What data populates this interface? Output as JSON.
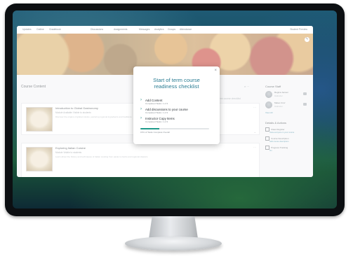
{
  "nav": {
    "items": [
      "Updates",
      "Outline",
      "Gradebook",
      "Discussions",
      "Assignments",
      "Messages",
      "Analytics",
      "Groups",
      "Attendance"
    ],
    "help": "Student Preview"
  },
  "content": {
    "title": "Course Content",
    "tools": "⌕  ···",
    "progress_note": "Start of term course checklist"
  },
  "modules": [
    {
      "title": "Introduction to Global Gastronomy",
      "meta": "Module   Available   Visible to students",
      "desc": "Discover the origins of global cuisine, exploring regional ingredients and traditions."
    },
    {
      "title": "Exploring Italian Cuisine",
      "meta": "Module   Visible to students",
      "desc": "Learn about the history and techniques of Italian cooking from pasta to risotto and regional classics."
    }
  ],
  "sidebar": {
    "staff_title": "Course Staff",
    "staff": [
      {
        "name": "Regina Jensen",
        "role": "Instructor"
      },
      {
        "name": "Mateo Cruz",
        "role": "Instructor"
      }
    ],
    "view_all": "View All",
    "details_title": "Details & Actions",
    "actions": [
      {
        "label": "Class Register",
        "sub": "View everyone in your course"
      },
      {
        "label": "Course Description",
        "sub": "Add course description"
      },
      {
        "label": "Progress Tracking",
        "sub": "On"
      }
    ]
  },
  "modal": {
    "title_line1": "Start of term course",
    "title_line2": "readiness checklist",
    "close": "×",
    "tasks": [
      {
        "name": "Add Content",
        "status": "Completed Tasks: 1 of 3"
      },
      {
        "name": "Add discussions to your course",
        "status": "Completed Tasks: 1 of 3"
      },
      {
        "name": "Instructor Copy Items",
        "status": "Completed Tasks: 1 of 3"
      }
    ],
    "progress": 0.28,
    "progress_label": "15% of Tasks Complete Overall",
    "accent": "#1f9a8a"
  }
}
